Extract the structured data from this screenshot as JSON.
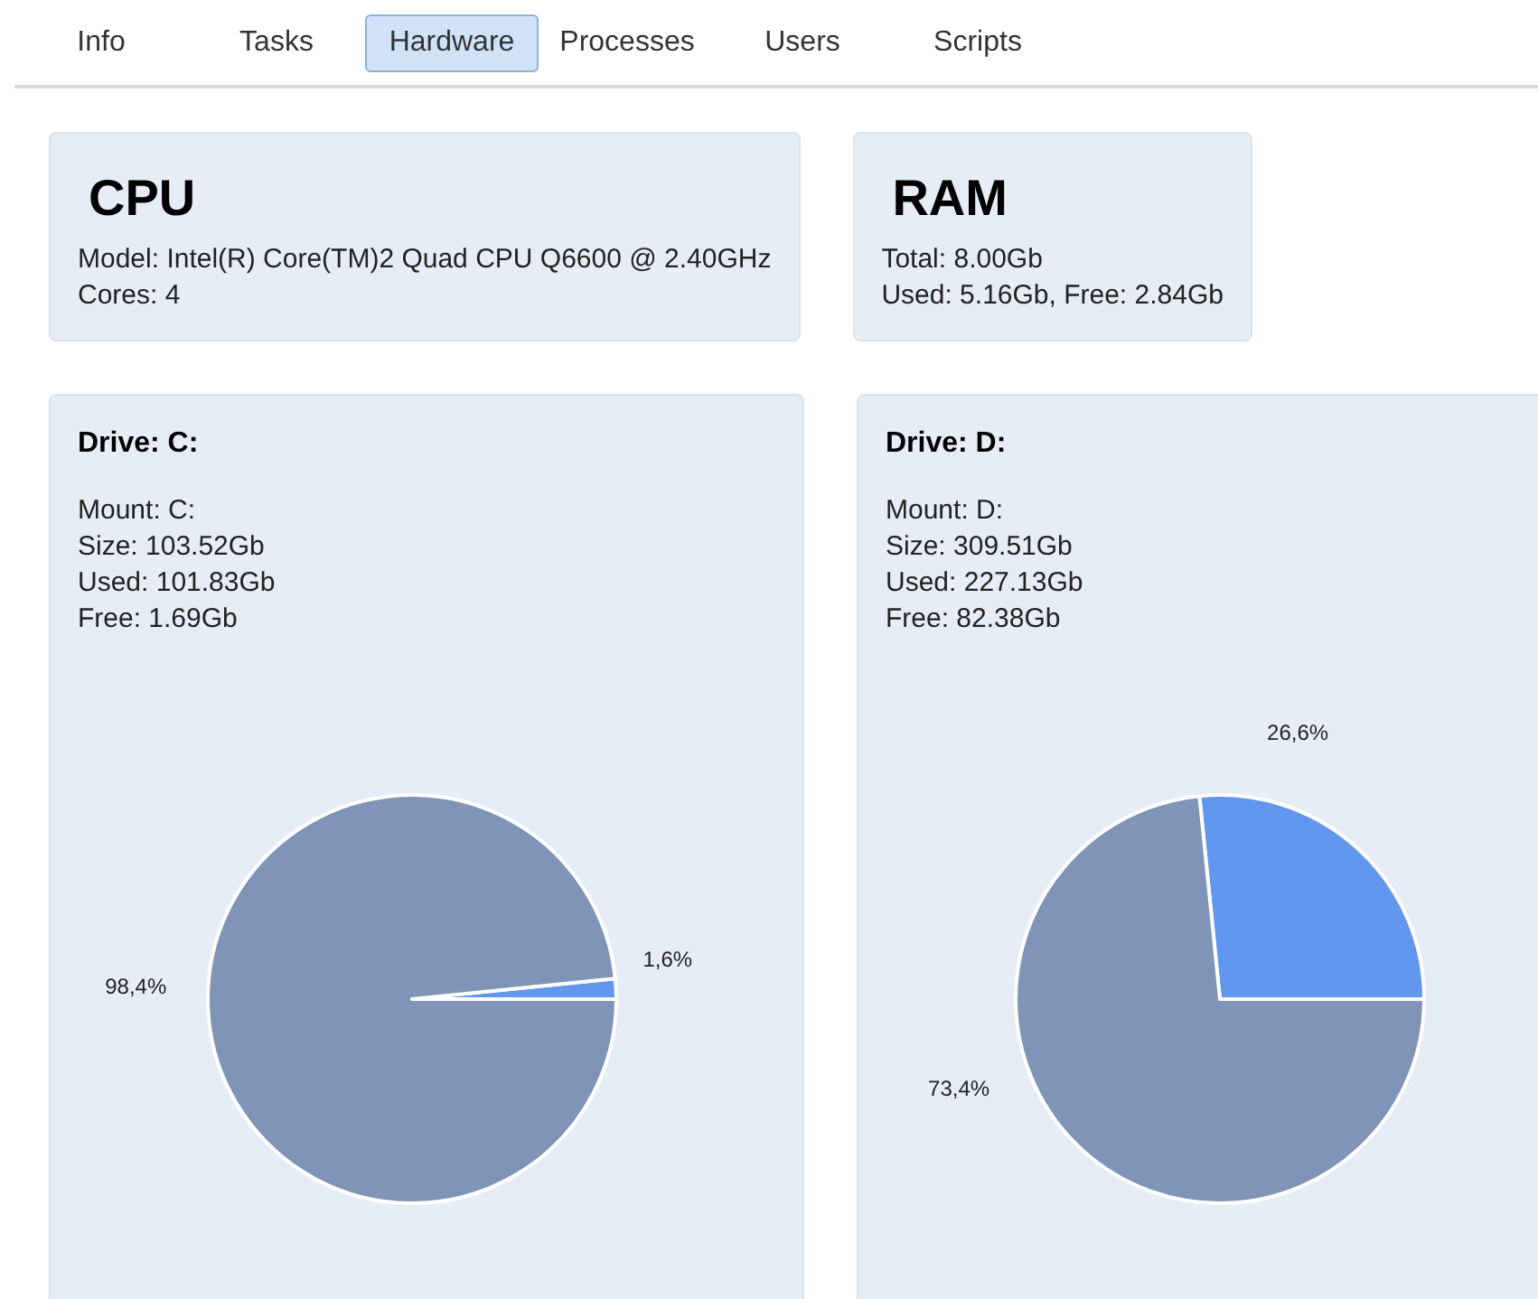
{
  "tabs": [
    {
      "label": "Info",
      "selected": false
    },
    {
      "label": "Tasks",
      "selected": false
    },
    {
      "label": "Hardware",
      "selected": true
    },
    {
      "label": "Processes",
      "selected": false
    },
    {
      "label": "Users",
      "selected": false
    },
    {
      "label": "Scripts",
      "selected": false
    }
  ],
  "cpu": {
    "title": "CPU",
    "lines": [
      "Model: Intel(R) Core(TM)2 Quad CPU Q6600 @ 2.40GHz",
      "Cores: 4"
    ]
  },
  "ram": {
    "title": "RAM",
    "lines": [
      "Total: 8.00Gb",
      "Used: 5.16Gb, Free: 2.84Gb"
    ]
  },
  "drives": [
    {
      "title": "Drive: C:",
      "lines": [
        "Mount: C:",
        "Size: 103.52Gb",
        "Used: 101.83Gb",
        "Free: 1.69Gb"
      ],
      "chart_data": {
        "type": "pie",
        "values": [
          1.6,
          98.4
        ],
        "value_labels": [
          "1,6%",
          "98,4%"
        ]
      }
    },
    {
      "title": "Drive: D:",
      "lines": [
        "Mount: D:",
        "Size: 309.51Gb",
        "Used: 227.13Gb",
        "Free: 82.38Gb"
      ],
      "chart_data": {
        "type": "pie",
        "values": [
          26.6,
          73.4
        ],
        "value_labels": [
          "26,6%",
          "73,4%"
        ]
      }
    }
  ]
}
